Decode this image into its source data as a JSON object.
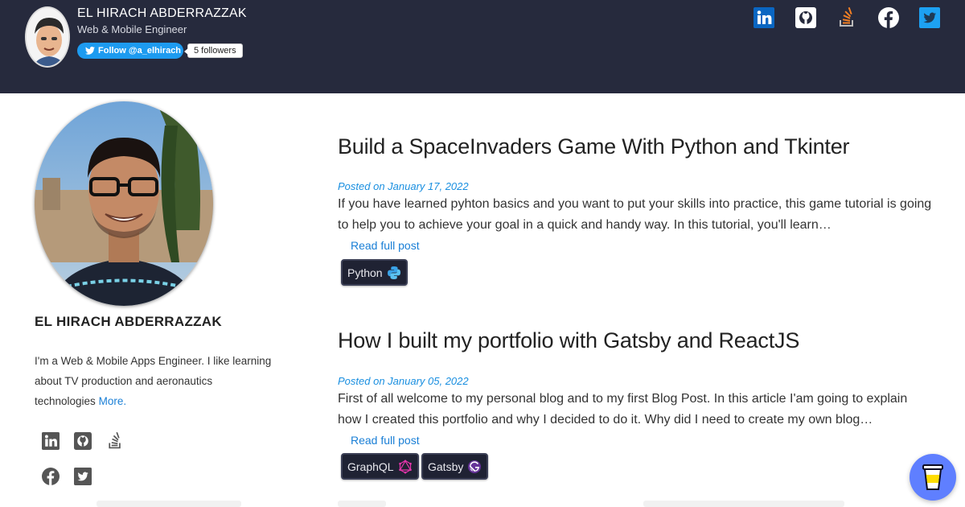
{
  "header": {
    "name": "EL HIRACH ABDERRAZZAK",
    "subtitle": "Web & Mobile Engineer",
    "follow_label": "Follow @a_elhirach",
    "followers": "5 followers",
    "social_icons": [
      "linkedin-icon",
      "github-icon",
      "stackoverflow-icon",
      "facebook-icon",
      "twitter-icon"
    ]
  },
  "sidebar": {
    "name": "EL HIRACH ABDERRAZZAK",
    "bio": "I'm a Web & Mobile Apps Engineer. I like learning about TV production and aeronautics technologies",
    "more_link": "More.",
    "social_icons": [
      "linkedin-icon",
      "github-icon",
      "stackoverflow-icon",
      "facebook-icon",
      "twitter-icon"
    ]
  },
  "posts": [
    {
      "title": "Build a SpaceInvaders Game With Python and Tkinter",
      "date": "Posted on January 17, 2022",
      "excerpt": "If you have learned pyhton basics and you want to put your skills into practice, this game tutorial is going to help you to achieve your goal in a quick and handy way. In this tutorial, you'll learn…",
      "read_more": "Read full post",
      "tags": [
        "Python"
      ]
    },
    {
      "title": "How I built my portfolio with Gatsby and ReactJS",
      "date": "Posted on January 05, 2022",
      "excerpt": "First of all welcome to my personal blog and to my first Blog Post. In this article I'am going to explain how I created this portfolio and why I decided to do it. Why did I need to create my own blog…",
      "read_more": "Read full post",
      "tags": [
        "GraphQL",
        "Gatsby"
      ]
    }
  ],
  "colors": {
    "header_bg": "#262a3d",
    "link": "#1a7fd6",
    "date": "#1a8fe0",
    "linkedin": "#0a66c2",
    "stackoverflow": "#f48024",
    "twitter": "#1da1f2",
    "coffee_button": "#5f7fff"
  }
}
